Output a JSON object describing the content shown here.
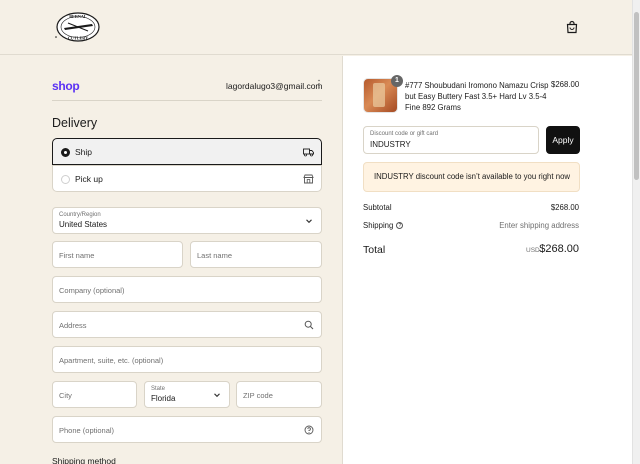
{
  "header": {
    "logo_name": "bernal-cutlery-logo",
    "logo_top_text": "BERNAL",
    "logo_bottom_text": "CUTLERY",
    "cart_icon": "shopping-bag-icon"
  },
  "account": {
    "shop_brand": "shop",
    "email": "lagordalugo3@gmail.com",
    "menu_glyph": "⋮"
  },
  "delivery": {
    "title": "Delivery",
    "options": [
      {
        "label": "Ship",
        "selected": true,
        "icon": "truck-icon"
      },
      {
        "label": "Pick up",
        "selected": false,
        "icon": "store-icon"
      }
    ]
  },
  "form": {
    "country_label": "Country/Region",
    "country_value": "United States",
    "first_name_placeholder": "First name",
    "last_name_placeholder": "Last name",
    "company_placeholder": "Company (optional)",
    "address_placeholder": "Address",
    "apartment_placeholder": "Apartment, suite, etc. (optional)",
    "city_placeholder": "City",
    "state_label": "State",
    "state_value": "Florida",
    "zip_placeholder": "ZIP code",
    "phone_placeholder": "Phone (optional)"
  },
  "shipping_method_title": "Shipping method",
  "order": {
    "product": {
      "quantity": "1",
      "name": "#777 Shoubudani Iromono Namazu Crisp but Easy Buttery Fast 3.5+ Hard Lv 3.5-4 Fine 892 Grams",
      "price": "$268.00"
    },
    "discount": {
      "label": "Discount code or gift card",
      "value": "INDUSTRY",
      "apply_label": "Apply",
      "notice": "INDUSTRY discount code isn’t available to you right now"
    },
    "subtotal_label": "Subtotal",
    "subtotal_value": "$268.00",
    "shipping_label": "Shipping",
    "shipping_value": "Enter shipping address",
    "total_label": "Total",
    "total_currency": "USD",
    "total_value": "$268.00"
  },
  "colors": {
    "background": "#f5f0e6",
    "shop_brand": "#5a31f4",
    "button": "#111111",
    "notice_bg": "#fff3e2"
  }
}
